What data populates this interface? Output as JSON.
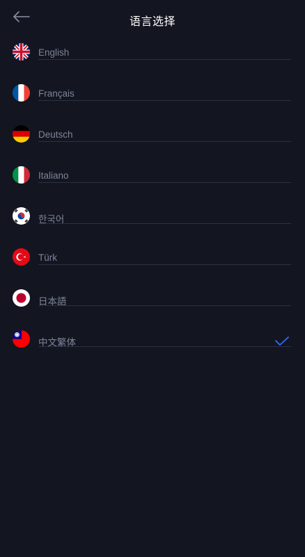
{
  "header": {
    "title": "语言选择",
    "back_icon": "arrow-left-icon"
  },
  "colors": {
    "background": "#131620",
    "title": "#ffffff",
    "label": "#7d849a",
    "divider": "#2c3140",
    "check": "#2f6bff"
  },
  "languages": [
    {
      "label": "English",
      "flag": "uk-flag-icon",
      "selected": false
    },
    {
      "label": "Français",
      "flag": "france-flag-icon",
      "selected": false
    },
    {
      "label": "Deutsch",
      "flag": "germany-flag-icon",
      "selected": false
    },
    {
      "label": "Italiano",
      "flag": "italy-flag-icon",
      "selected": false
    },
    {
      "label": "한국어",
      "flag": "korea-flag-icon",
      "selected": false
    },
    {
      "label": "Türk",
      "flag": "turkey-flag-icon",
      "selected": false
    },
    {
      "label": "日本語",
      "flag": "japan-flag-icon",
      "selected": false
    },
    {
      "label": "中文繁体",
      "flag": "taiwan-flag-icon",
      "selected": true
    }
  ],
  "selected_icon": "checkmark-icon"
}
